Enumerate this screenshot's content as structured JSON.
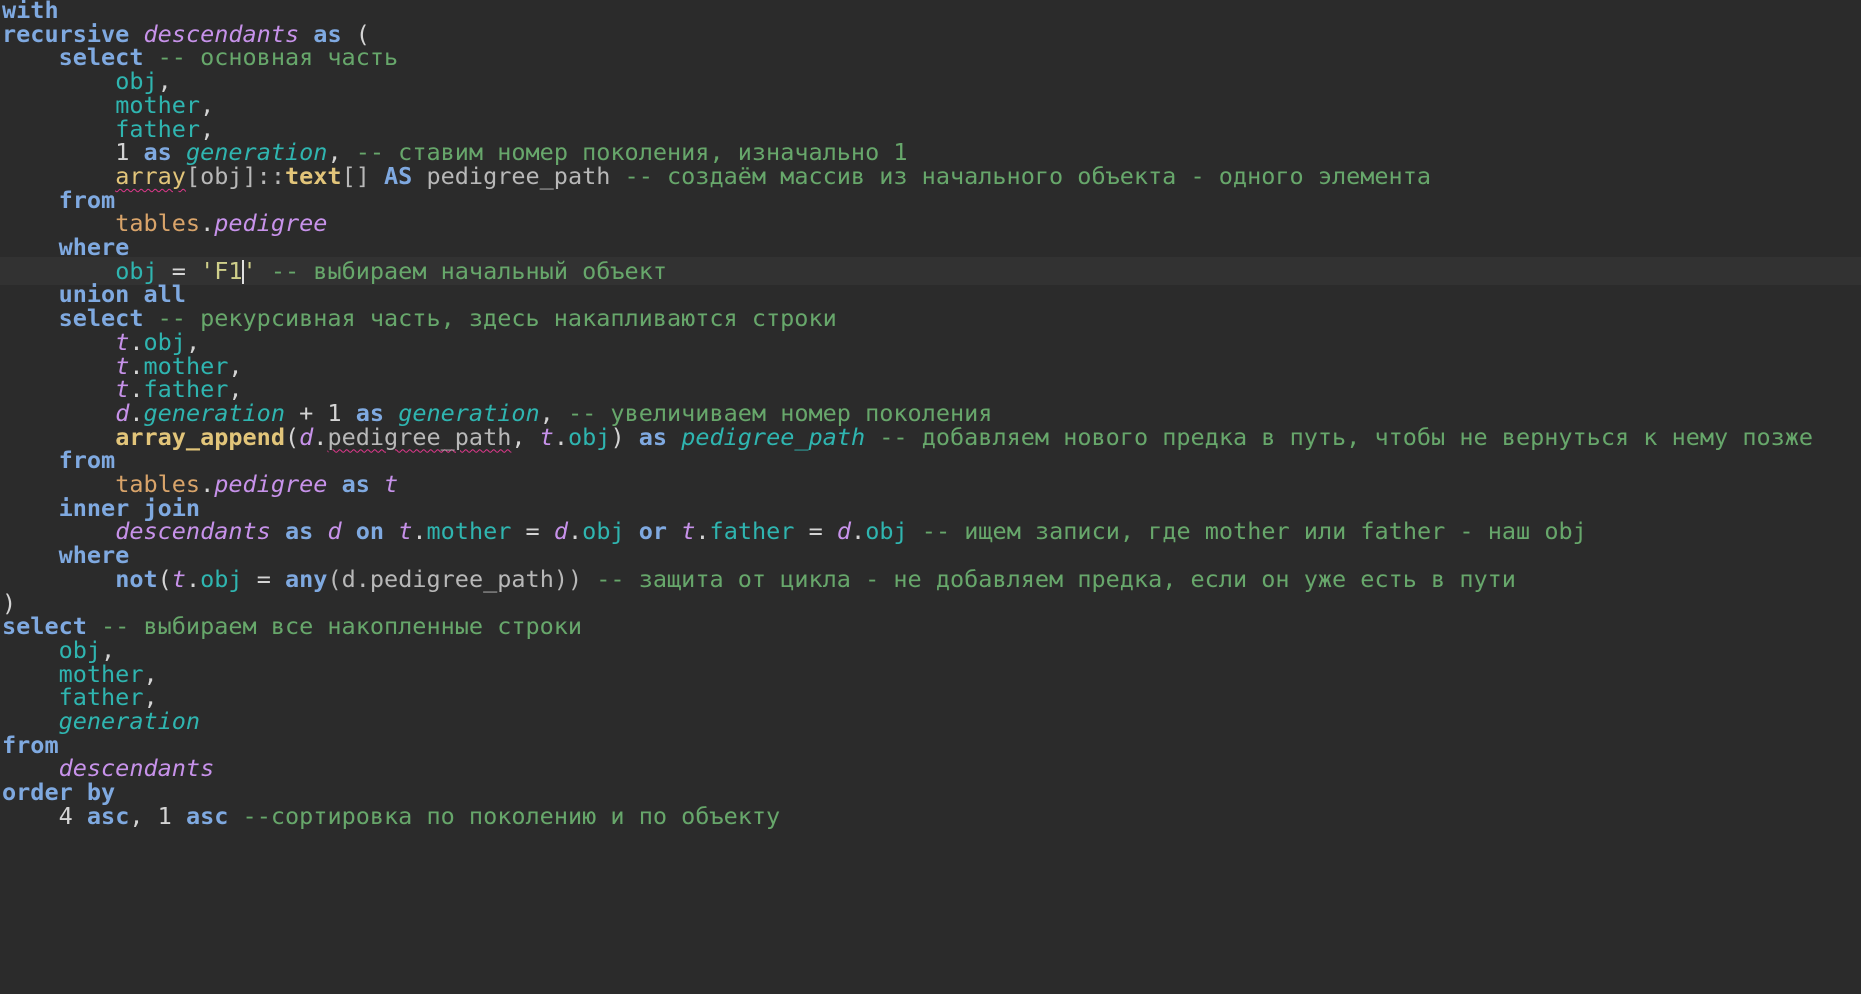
{
  "editor": {
    "language": "SQL",
    "current_line": 12,
    "colors": {
      "background": "#2b2b2b",
      "keyword": "#7fa9e0",
      "column": "#2fb5b0",
      "table": "#d9a46a",
      "alias": "#c792ea",
      "function": "#e2c57a",
      "comment": "#67a76b",
      "string": "#cfcf8a"
    },
    "lines": [
      [
        {
          "t": "with",
          "c": "kw"
        }
      ],
      [
        {
          "t": "recursive",
          "c": "kw"
        },
        {
          "t": " ",
          "c": "plain"
        },
        {
          "t": "descendants",
          "c": "cte"
        },
        {
          "t": " ",
          "c": "plain"
        },
        {
          "t": "as",
          "c": "kw"
        },
        {
          "t": " (",
          "c": "op"
        }
      ],
      [
        {
          "t": "    ",
          "c": "plain"
        },
        {
          "t": "select",
          "c": "kw"
        },
        {
          "t": " -- основная часть",
          "c": "cmt"
        }
      ],
      [
        {
          "t": "        ",
          "c": "plain"
        },
        {
          "t": "obj",
          "c": "col"
        },
        {
          "t": ",",
          "c": "op"
        }
      ],
      [
        {
          "t": "        ",
          "c": "plain"
        },
        {
          "t": "mother",
          "c": "col"
        },
        {
          "t": ",",
          "c": "op"
        }
      ],
      [
        {
          "t": "        ",
          "c": "plain"
        },
        {
          "t": "father",
          "c": "col"
        },
        {
          "t": ",",
          "c": "op"
        }
      ],
      [
        {
          "t": "        ",
          "c": "plain"
        },
        {
          "t": "1",
          "c": "op"
        },
        {
          "t": " ",
          "c": "plain"
        },
        {
          "t": "as",
          "c": "kw"
        },
        {
          "t": " ",
          "c": "plain"
        },
        {
          "t": "generation",
          "c": "colit"
        },
        {
          "t": ",",
          "c": "op"
        },
        {
          "t": " -- ставим номер поколения, изначально 1",
          "c": "cmt"
        }
      ],
      [
        {
          "t": "        ",
          "c": "plain"
        },
        {
          "t": "array",
          "c": "fnp squiggle"
        },
        {
          "t": "[obj]::",
          "c": "plain"
        },
        {
          "t": "text",
          "c": "fn"
        },
        {
          "t": "[] ",
          "c": "plain"
        },
        {
          "t": "AS",
          "c": "kw"
        },
        {
          "t": " pedigree_path",
          "c": "plain"
        },
        {
          "t": " -- создаём массив из начального объекта - одного элемента",
          "c": "cmt"
        }
      ],
      [
        {
          "t": "    ",
          "c": "plain"
        },
        {
          "t": "from",
          "c": "kw"
        }
      ],
      [
        {
          "t": "        ",
          "c": "plain"
        },
        {
          "t": "tables",
          "c": "tbl"
        },
        {
          "t": ".",
          "c": "op"
        },
        {
          "t": "pedigree",
          "c": "alias"
        }
      ],
      [
        {
          "t": "    ",
          "c": "plain"
        },
        {
          "t": "where",
          "c": "kw"
        }
      ],
      [
        {
          "t": "        ",
          "c": "plain"
        },
        {
          "t": "obj",
          "c": "col"
        },
        {
          "t": " = ",
          "c": "op"
        },
        {
          "t": "'F1",
          "c": "str"
        },
        {
          "t": "|",
          "c": "cursor"
        },
        {
          "t": "'",
          "c": "str"
        },
        {
          "t": " -- выбираем начальный объект",
          "c": "cmt"
        }
      ],
      [
        {
          "t": "    ",
          "c": "plain"
        },
        {
          "t": "union all",
          "c": "kw"
        }
      ],
      [
        {
          "t": "    ",
          "c": "plain"
        },
        {
          "t": "select",
          "c": "kw"
        },
        {
          "t": " -- рекурсивная часть, здесь накапливаются строки",
          "c": "cmt"
        }
      ],
      [
        {
          "t": "        ",
          "c": "plain"
        },
        {
          "t": "t",
          "c": "alias"
        },
        {
          "t": ".",
          "c": "op"
        },
        {
          "t": "obj",
          "c": "col"
        },
        {
          "t": ",",
          "c": "op"
        }
      ],
      [
        {
          "t": "        ",
          "c": "plain"
        },
        {
          "t": "t",
          "c": "alias"
        },
        {
          "t": ".",
          "c": "op"
        },
        {
          "t": "mother",
          "c": "col"
        },
        {
          "t": ",",
          "c": "op"
        }
      ],
      [
        {
          "t": "        ",
          "c": "plain"
        },
        {
          "t": "t",
          "c": "alias"
        },
        {
          "t": ".",
          "c": "op"
        },
        {
          "t": "father",
          "c": "col"
        },
        {
          "t": ",",
          "c": "op"
        }
      ],
      [
        {
          "t": "        ",
          "c": "plain"
        },
        {
          "t": "d",
          "c": "alias"
        },
        {
          "t": ".",
          "c": "op"
        },
        {
          "t": "generation",
          "c": "colit"
        },
        {
          "t": " + 1 ",
          "c": "op"
        },
        {
          "t": "as",
          "c": "kw"
        },
        {
          "t": " ",
          "c": "plain"
        },
        {
          "t": "generation",
          "c": "colit"
        },
        {
          "t": ",",
          "c": "op"
        },
        {
          "t": " -- увеличиваем номер поколения",
          "c": "cmt"
        }
      ],
      [
        {
          "t": "        ",
          "c": "plain"
        },
        {
          "t": "array_append",
          "c": "fn"
        },
        {
          "t": "(",
          "c": "op"
        },
        {
          "t": "d",
          "c": "alias"
        },
        {
          "t": ".",
          "c": "op"
        },
        {
          "t": "pedigree_path",
          "c": "plain squiggle"
        },
        {
          "t": ", ",
          "c": "op"
        },
        {
          "t": "t",
          "c": "alias"
        },
        {
          "t": ".",
          "c": "op"
        },
        {
          "t": "obj",
          "c": "col"
        },
        {
          "t": ") ",
          "c": "op"
        },
        {
          "t": "as",
          "c": "kw"
        },
        {
          "t": " ",
          "c": "plain"
        },
        {
          "t": "pedigree_path",
          "c": "colit"
        },
        {
          "t": " -- добавляем нового предка в путь, чтобы не вернуться к нему позже",
          "c": "cmt"
        }
      ],
      [
        {
          "t": "    ",
          "c": "plain"
        },
        {
          "t": "from",
          "c": "kw"
        }
      ],
      [
        {
          "t": "        ",
          "c": "plain"
        },
        {
          "t": "tables",
          "c": "tbl"
        },
        {
          "t": ".",
          "c": "op"
        },
        {
          "t": "pedigree",
          "c": "alias"
        },
        {
          "t": " ",
          "c": "plain"
        },
        {
          "t": "as",
          "c": "kw"
        },
        {
          "t": " ",
          "c": "plain"
        },
        {
          "t": "t",
          "c": "alias"
        }
      ],
      [
        {
          "t": "    ",
          "c": "plain"
        },
        {
          "t": "inner join",
          "c": "kw"
        }
      ],
      [
        {
          "t": "        ",
          "c": "plain"
        },
        {
          "t": "descendants",
          "c": "cte"
        },
        {
          "t": " ",
          "c": "plain"
        },
        {
          "t": "as",
          "c": "kw"
        },
        {
          "t": " ",
          "c": "plain"
        },
        {
          "t": "d",
          "c": "alias"
        },
        {
          "t": " ",
          "c": "plain"
        },
        {
          "t": "on",
          "c": "kw"
        },
        {
          "t": " ",
          "c": "plain"
        },
        {
          "t": "t",
          "c": "alias"
        },
        {
          "t": ".",
          "c": "op"
        },
        {
          "t": "mother",
          "c": "col"
        },
        {
          "t": " = ",
          "c": "op"
        },
        {
          "t": "d",
          "c": "alias"
        },
        {
          "t": ".",
          "c": "op"
        },
        {
          "t": "obj",
          "c": "col"
        },
        {
          "t": " ",
          "c": "plain"
        },
        {
          "t": "or",
          "c": "kw"
        },
        {
          "t": " ",
          "c": "plain"
        },
        {
          "t": "t",
          "c": "alias"
        },
        {
          "t": ".",
          "c": "op"
        },
        {
          "t": "father",
          "c": "col"
        },
        {
          "t": " = ",
          "c": "op"
        },
        {
          "t": "d",
          "c": "alias"
        },
        {
          "t": ".",
          "c": "op"
        },
        {
          "t": "obj",
          "c": "col"
        },
        {
          "t": " -- ищем записи, где mother или father - наш obj",
          "c": "cmt"
        }
      ],
      [
        {
          "t": "    ",
          "c": "plain"
        },
        {
          "t": "where",
          "c": "kw"
        }
      ],
      [
        {
          "t": "        ",
          "c": "plain"
        },
        {
          "t": "not",
          "c": "kw"
        },
        {
          "t": "(",
          "c": "op"
        },
        {
          "t": "t",
          "c": "alias"
        },
        {
          "t": ".",
          "c": "op"
        },
        {
          "t": "obj",
          "c": "col"
        },
        {
          "t": " = ",
          "c": "op"
        },
        {
          "t": "any",
          "c": "kw"
        },
        {
          "t": "(d.pedigree_path))",
          "c": "plain"
        },
        {
          "t": " -- защита от цикла - не добавляем предка, если он уже есть в пути",
          "c": "cmt"
        }
      ],
      [
        {
          "t": ")",
          "c": "op"
        }
      ],
      [
        {
          "t": "select",
          "c": "kw"
        },
        {
          "t": " -- выбираем все накопленные строки",
          "c": "cmt"
        }
      ],
      [
        {
          "t": "    ",
          "c": "plain"
        },
        {
          "t": "obj",
          "c": "col"
        },
        {
          "t": ",",
          "c": "op"
        }
      ],
      [
        {
          "t": "    ",
          "c": "plain"
        },
        {
          "t": "mother",
          "c": "col"
        },
        {
          "t": ",",
          "c": "op"
        }
      ],
      [
        {
          "t": "    ",
          "c": "plain"
        },
        {
          "t": "father",
          "c": "col"
        },
        {
          "t": ",",
          "c": "op"
        }
      ],
      [
        {
          "t": "    ",
          "c": "plain"
        },
        {
          "t": "generation",
          "c": "colit"
        }
      ],
      [
        {
          "t": "from",
          "c": "kw"
        }
      ],
      [
        {
          "t": "    ",
          "c": "plain"
        },
        {
          "t": "descendants",
          "c": "cte"
        }
      ],
      [
        {
          "t": "order by",
          "c": "kw"
        }
      ],
      [
        {
          "t": "    ",
          "c": "plain"
        },
        {
          "t": "4",
          "c": "op"
        },
        {
          "t": " ",
          "c": "plain"
        },
        {
          "t": "asc",
          "c": "kw"
        },
        {
          "t": ", 1 ",
          "c": "op"
        },
        {
          "t": "asc",
          "c": "kw"
        },
        {
          "t": " --сортировка по поколению и по объекту",
          "c": "cmt"
        }
      ]
    ]
  }
}
